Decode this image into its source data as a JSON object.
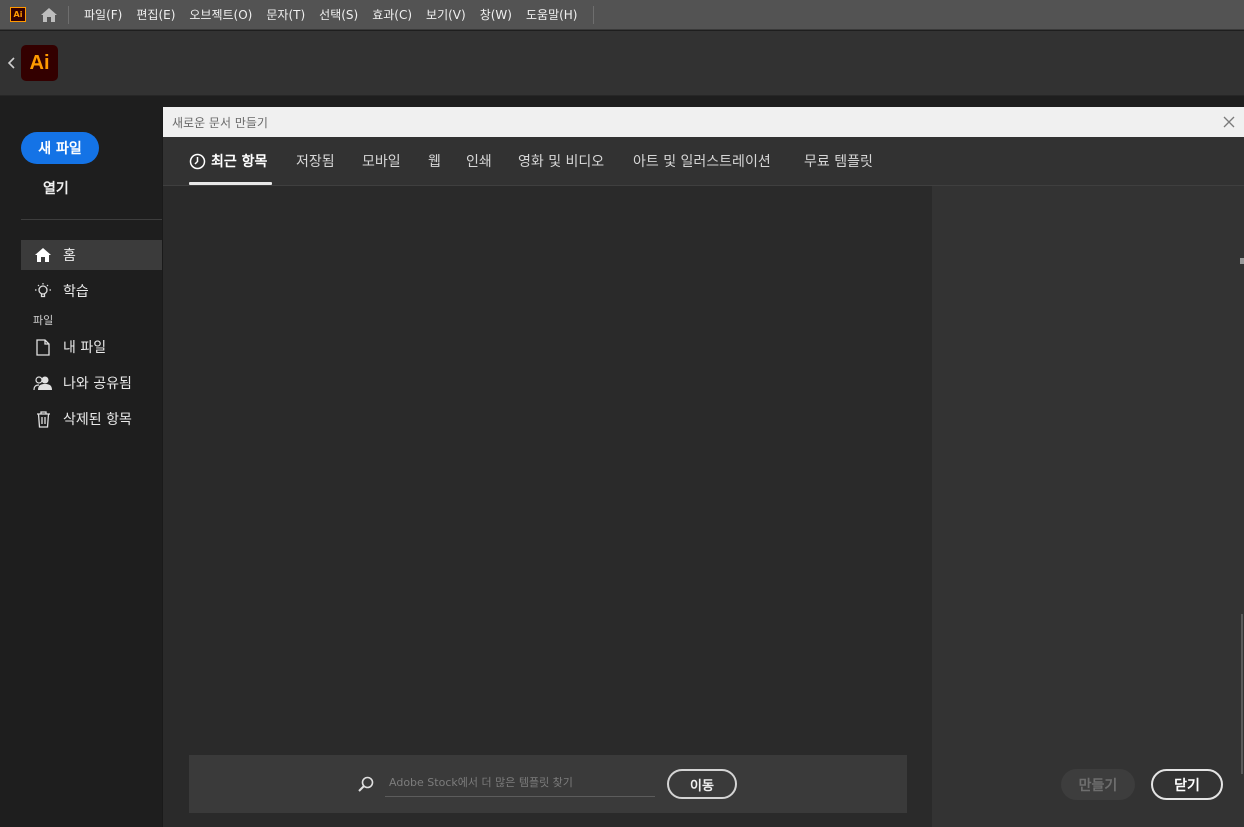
{
  "menubar": {
    "app_badge": "Ai",
    "items": [
      "파일(F)",
      "편집(E)",
      "오브젝트(O)",
      "문자(T)",
      "선택(S)",
      "효과(C)",
      "보기(V)",
      "창(W)",
      "도움말(H)"
    ]
  },
  "header": {
    "logo_text": "Ai"
  },
  "sidebar": {
    "new_file": "새 파일",
    "open": "열기",
    "nav": [
      {
        "label": "홈",
        "icon": "home-icon",
        "active": true
      },
      {
        "label": "학습",
        "icon": "lightbulb-icon",
        "active": false
      }
    ],
    "section_label": "파일",
    "files_nav": [
      {
        "label": "내 파일",
        "icon": "document-icon"
      },
      {
        "label": "나와 공유됨",
        "icon": "shared-users-icon"
      },
      {
        "label": "삭제된 항목",
        "icon": "trash-icon"
      }
    ]
  },
  "dialog": {
    "title": "새로운 문서 만들기",
    "tabs": [
      {
        "label": "최근 항목",
        "active": true
      },
      {
        "label": "저장됨"
      },
      {
        "label": "모바일"
      },
      {
        "label": "웹"
      },
      {
        "label": "인쇄"
      },
      {
        "label": "영화 및 비디오"
      },
      {
        "label": "아트 및 일러스트레이션"
      },
      {
        "label": "무료 템플릿"
      }
    ],
    "search": {
      "placeholder": "Adobe Stock에서 더 많은 템플릿 찾기",
      "go_label": "이동"
    },
    "create_label": "만들기",
    "close_label": "닫기"
  },
  "colors": {
    "accent": "#1473e6",
    "ai_brand": "#ff9a00",
    "ai_brand_bg": "#330000"
  }
}
